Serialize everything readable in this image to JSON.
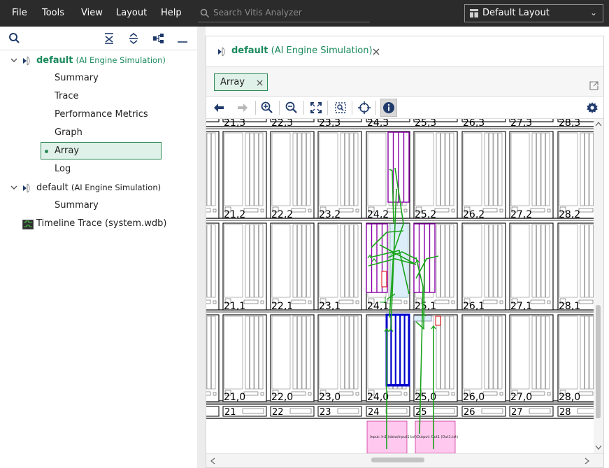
{
  "menubar": {
    "file": "File",
    "tools": "Tools",
    "view": "View",
    "layout": "Layout",
    "help": "Help"
  },
  "search": {
    "placeholder": "Search Vitis Analyzer"
  },
  "layout_selector": {
    "value": "Default Layout"
  },
  "tree": {
    "run1": {
      "name": "default",
      "type": "(AI Engine Simulation)"
    },
    "run1_items": [
      "Summary",
      "Trace",
      "Performance Metrics",
      "Graph",
      "Array",
      "Log"
    ],
    "run2": {
      "name": "default",
      "type": "(AI Engine Simulation)"
    },
    "run2_items": [
      "Summary"
    ],
    "timeline": "Timeline Trace (system.wdb)"
  },
  "editor_tab": {
    "name": "default",
    "type": "(AI Engine Simulation)"
  },
  "view_tab": {
    "label": "Array"
  },
  "array": {
    "tile_columns": [
      21,
      22,
      23,
      24,
      25,
      26,
      27,
      28
    ],
    "tile_rows": [
      3,
      2,
      1,
      0
    ],
    "tile_labels": {
      "row3": [
        "21,3",
        "22,3",
        "23,3",
        "24,3",
        "25,3",
        "26,3",
        "27,3",
        "28,3"
      ],
      "row2": [
        "21,2",
        "22,2",
        "23,2",
        "24,2",
        "25,2",
        "26,2",
        "27,2",
        "28,2"
      ],
      "row1": [
        "21,1",
        "22,1",
        "23,1",
        "24,1",
        "25,1",
        "26,1",
        "27,1",
        "28,1"
      ],
      "row0": [
        "21,0",
        "22,0",
        "23,0",
        "24,0",
        "25,0",
        "26,0",
        "27,0",
        "28,0"
      ]
    },
    "shim_labels": [
      "21",
      "22",
      "23",
      "24",
      "25",
      "26",
      "27",
      "28"
    ],
    "plio_input": "Input: In1 (data/input1.txt)",
    "plio_output": "Output: Out1 (Out1.txt)",
    "colors": {
      "kernel_tile": "#0000cc",
      "buffer": "#8b00a8",
      "net": "#1aa31a",
      "plio": "#ffc8ef",
      "lock": "#e00000"
    }
  },
  "icons": {
    "left_toolbar": [
      "search-icon",
      "collapse-all-icon",
      "expand-all-icon",
      "hierarchy-icon",
      "minimize-icon"
    ],
    "array_toolbar": [
      "back-icon",
      "forward-icon",
      "zoom-in-icon",
      "zoom-out-icon",
      "zoom-fit-icon",
      "zoom-area-icon",
      "crosshair-icon",
      "info-icon",
      "settings-icon"
    ]
  }
}
